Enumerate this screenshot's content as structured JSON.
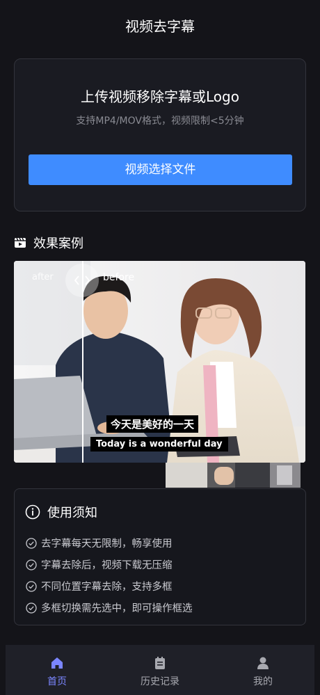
{
  "header": {
    "title": "视频去字幕"
  },
  "upload": {
    "title": "上传视频移除字幕或Logo",
    "subtitle": "支持MP4/MOV格式，视频限制<5分钟",
    "button_label": "视频选择文件"
  },
  "examples": {
    "title": "效果案例",
    "after_label": "after",
    "before_label": "before",
    "caption_cn": "今天是美好的一天",
    "caption_en": "Today is a wonderful day"
  },
  "notice": {
    "title": "使用须知",
    "items": [
      "去字幕每天无限制，畅享使用",
      "字幕去除后，视频下载无压缩",
      "不同位置字幕去除，支持多框",
      "多框切换需先选中，即可操作框选"
    ]
  },
  "tabbar": {
    "items": [
      {
        "label": "首页",
        "icon": "home-icon",
        "active": true
      },
      {
        "label": "历史记录",
        "icon": "history-icon",
        "active": false
      },
      {
        "label": "我的",
        "icon": "user-icon",
        "active": false
      }
    ],
    "active_color": "#7b86ff",
    "inactive_color": "#a8a9b0"
  },
  "colors": {
    "accent": "#3f8cff",
    "background": "#141419"
  }
}
